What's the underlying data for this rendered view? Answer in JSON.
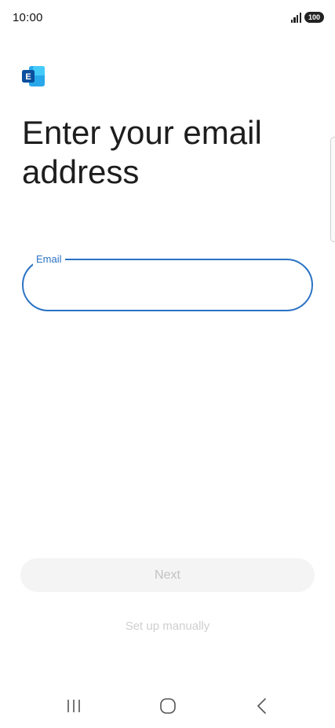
{
  "status_bar": {
    "time": "10:00",
    "battery": "100",
    "signal_icon": "signal-bars-icon"
  },
  "app": {
    "logo_icon": "exchange-logo-icon",
    "logo_letter": "E",
    "brand_color_dark": "#0a4f9e",
    "brand_color_light": "#28a8ea"
  },
  "page": {
    "title": "Enter your email address"
  },
  "email_field": {
    "label": "Email",
    "value": "",
    "accent_color": "#2a72c4"
  },
  "actions": {
    "next_label": "Next",
    "manual_label": "Set up manually"
  },
  "nav_bar": {
    "recents_icon": "recents-icon",
    "home_icon": "home-icon",
    "back_icon": "back-icon"
  }
}
